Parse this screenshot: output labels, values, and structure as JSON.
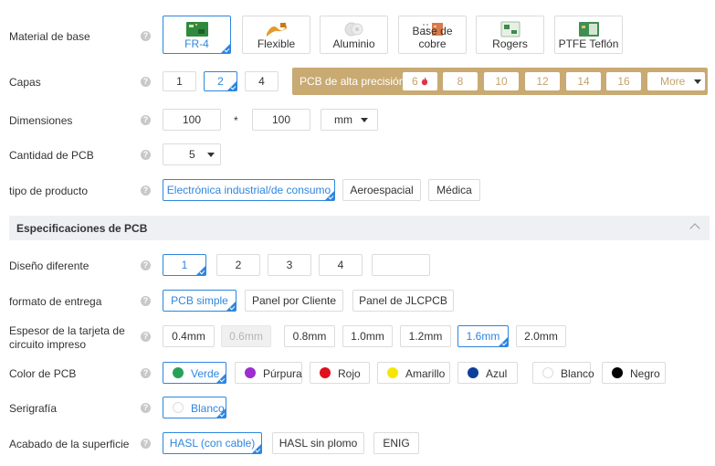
{
  "help_glyph": "?",
  "material": {
    "label": "Material de base",
    "options": [
      {
        "label": "FR-4",
        "selected": true
      },
      {
        "label": "Flexible"
      },
      {
        "label": "Aluminio"
      },
      {
        "label": "Base de cobre"
      },
      {
        "label": "Rogers"
      },
      {
        "label": "PTFE Teflón"
      }
    ]
  },
  "layers": {
    "label": "Capas",
    "options": [
      "1",
      "2",
      "4"
    ],
    "selected": "2",
    "high_precision_label": "PCB de alta precisión",
    "high_precision_options": [
      "6",
      "8",
      "10",
      "12",
      "14",
      "16"
    ],
    "more_label": "More"
  },
  "dimensions": {
    "label": "Dimensiones",
    "width": "100",
    "separator": "*",
    "height": "100",
    "unit": "mm"
  },
  "quantity": {
    "label": "Cantidad de PCB",
    "value": "5"
  },
  "product_type": {
    "label": "tipo de producto",
    "options": [
      "Electrónica industrial/de consumo",
      "Aeroespacial",
      "Médica"
    ],
    "selected": "Electrónica industrial/de consumo"
  },
  "section": {
    "title": "Especificaciones de PCB"
  },
  "design": {
    "label": "Diseño diferente",
    "options": [
      "1",
      "2",
      "3",
      "4",
      ""
    ],
    "selected": "1"
  },
  "delivery": {
    "label": "formato de entrega",
    "options": [
      "PCB simple",
      "Panel por Cliente",
      "Panel de JLCPCB"
    ],
    "selected": "PCB simple"
  },
  "thickness": {
    "label_line1": "Espesor de la tarjeta de",
    "label_line2": "circuito impreso",
    "options": [
      "0.4mm",
      "0.6mm",
      "0.8mm",
      "1.0mm",
      "1.2mm",
      "1.6mm",
      "2.0mm"
    ],
    "selected": "1.6mm",
    "disabled": "0.6mm"
  },
  "color": {
    "label": "Color de PCB",
    "options": [
      {
        "label": "Verde",
        "color": "#27a05a"
      },
      {
        "label": "Púrpura",
        "color": "#9b2fcf"
      },
      {
        "label": "Rojo",
        "color": "#e0101e"
      },
      {
        "label": "Amarillo",
        "color": "#f5e60a"
      },
      {
        "label": "Azul",
        "color": "#0d3f9a"
      },
      {
        "label": "Blanco",
        "color": "#ffffff"
      },
      {
        "label": "Negro",
        "color": "#000000"
      }
    ],
    "selected": "Verde"
  },
  "silkscreen": {
    "label": "Serigrafía",
    "option": "Blanco"
  },
  "finish": {
    "label": "Acabado de la superficie",
    "options": [
      "HASL (con cable)",
      "HASL sin plomo",
      "ENIG"
    ],
    "selected": "HASL (con cable)"
  },
  "colors": {
    "accent": "#2e86de",
    "gold": "#c8aa72",
    "flame": "#e0334a"
  }
}
